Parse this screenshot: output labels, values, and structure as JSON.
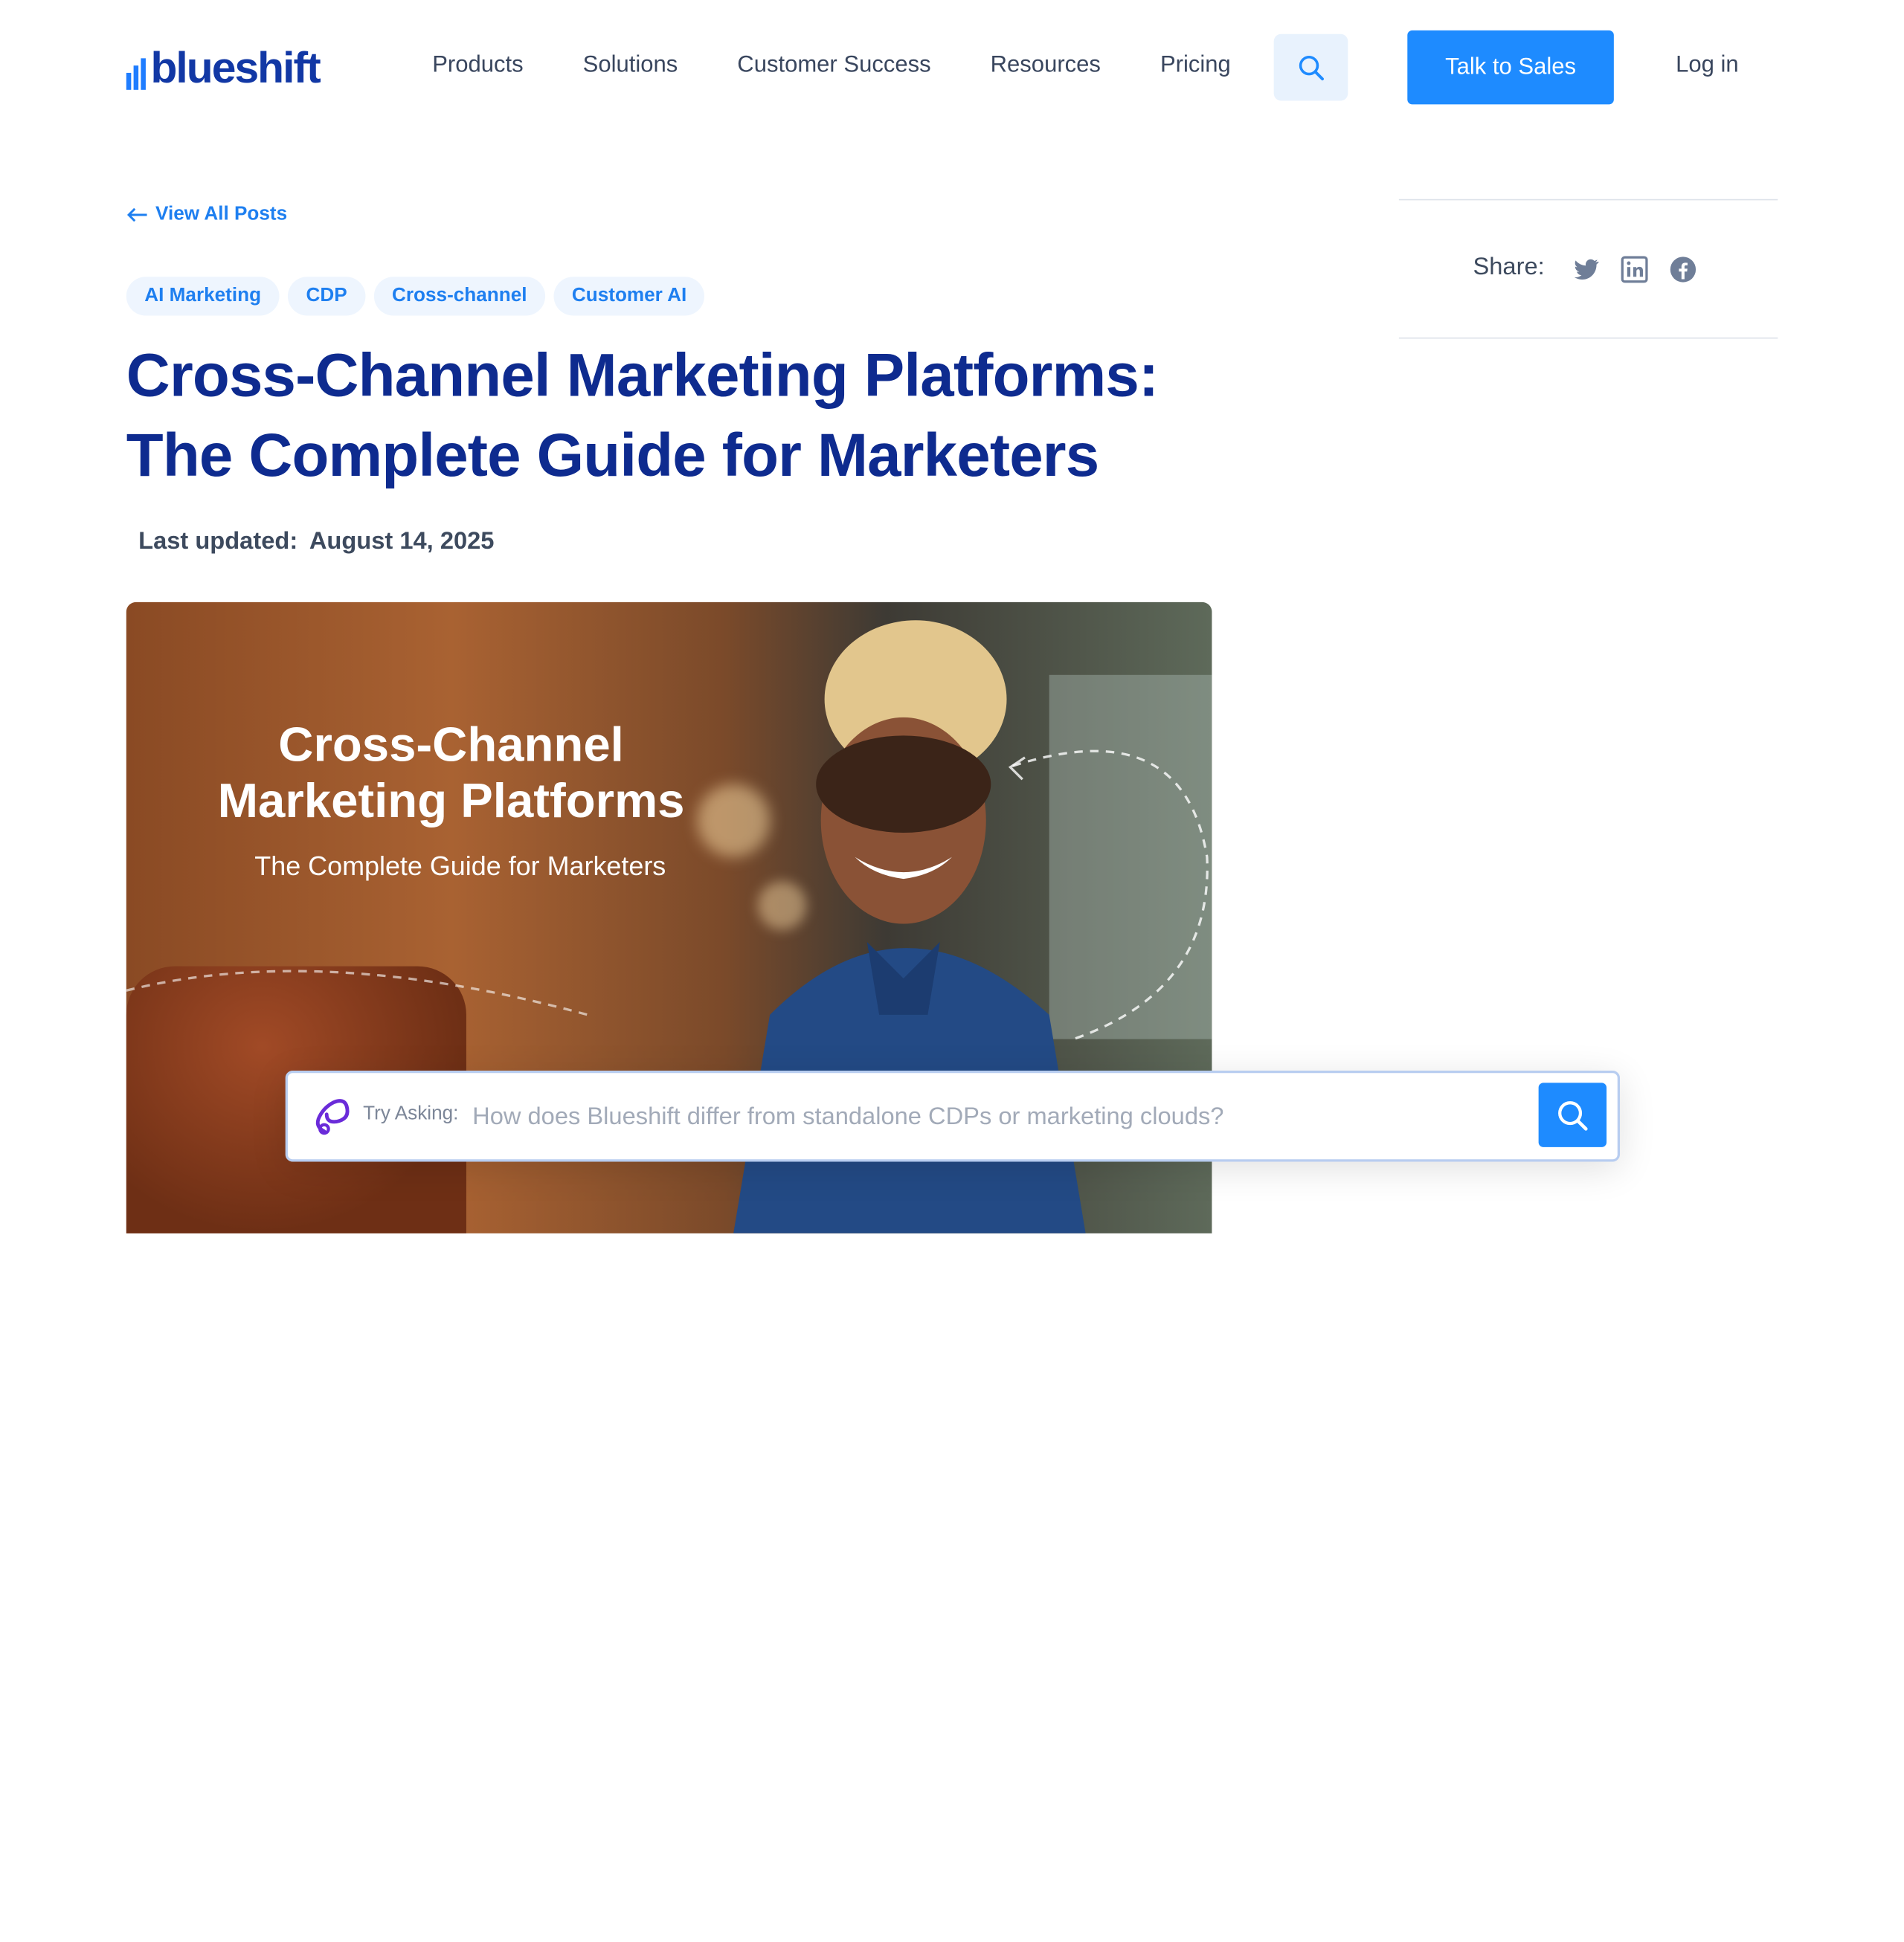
{
  "brand": {
    "name": "blueshift"
  },
  "nav": {
    "items": [
      "Products",
      "Solutions",
      "Customer Success",
      "Resources",
      "Pricing"
    ],
    "cta_label": "Talk to Sales",
    "login_label": "Log in"
  },
  "post": {
    "back_label": "View All Posts",
    "tags": [
      "AI Marketing",
      "CDP",
      "Cross-channel",
      "Customer AI"
    ],
    "title": "Cross-Channel Marketing Platforms: The Complete Guide for Marketers",
    "updated_label": "Last updated:",
    "updated_date": "August 14, 2025"
  },
  "share": {
    "label": "Share:",
    "icons": [
      "twitter-icon",
      "linkedin-icon",
      "facebook-icon"
    ]
  },
  "hero": {
    "heading": "Cross-Channel Marketing Platforms",
    "subheading": "The Complete Guide for Marketers"
  },
  "ask": {
    "label": "Try Asking:",
    "placeholder": "How does Blueshift differ from standalone CDPs or marketing clouds?"
  },
  "colors": {
    "primary": "#1e8bff",
    "title": "#0e2b8f",
    "logo": "#1238a5"
  }
}
